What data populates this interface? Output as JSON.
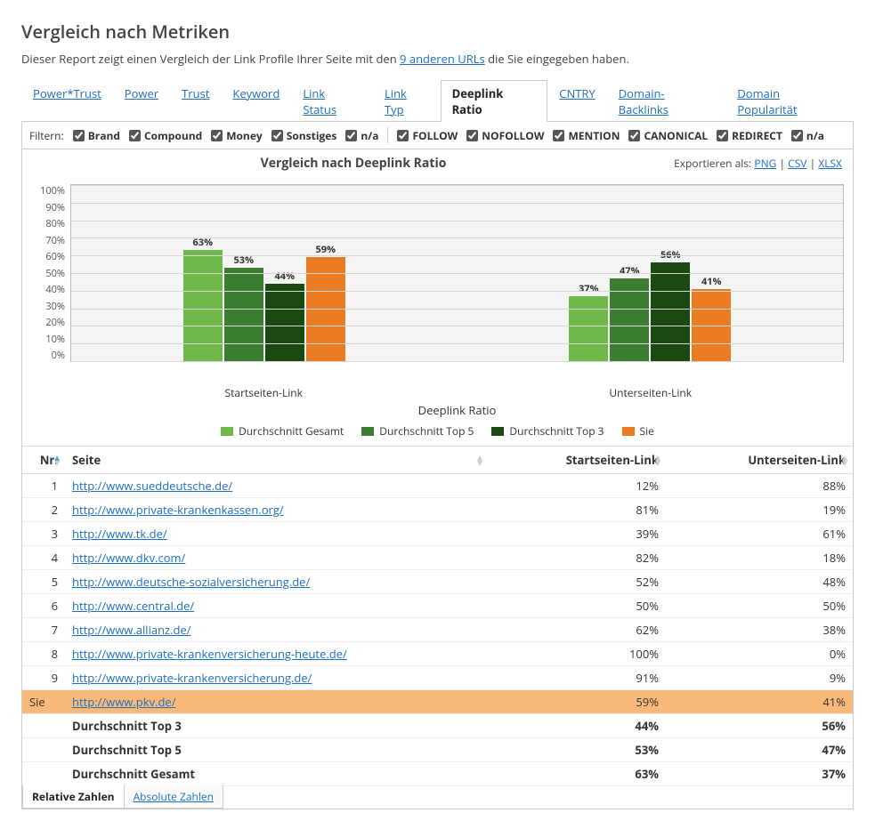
{
  "title": "Vergleich nach Metriken",
  "subtitle_a": "Dieser Report zeigt einen Vergleich der Link Profile Ihrer Seite mit den ",
  "subtitle_link": "9 anderen URLs",
  "subtitle_b": " die Sie eingegeben haben.",
  "tabs": [
    "Power*Trust",
    "Power",
    "Trust",
    "Keyword",
    "Link Status",
    "Link Typ",
    "Deeplink Ratio",
    "CNTRY",
    "Domain-Backlinks",
    "Domain Popularität"
  ],
  "active_tab": "Deeplink Ratio",
  "filter_label": "Filtern:",
  "filters_a": [
    "Brand",
    "Compound",
    "Money",
    "Sonstiges",
    "n/a"
  ],
  "filters_b": [
    "FOLLOW",
    "NOFOLLOW",
    "MENTION",
    "CANONICAL",
    "REDIRECT",
    "n/a"
  ],
  "chart_title": "Vergleich nach Deeplink Ratio",
  "export_label": "Exportieren als:",
  "export_formats": [
    "PNG",
    "CSV",
    "XLSX"
  ],
  "yticks": [
    "100%",
    "90%",
    "80%",
    "70%",
    "60%",
    "50%",
    "40%",
    "30%",
    "20%",
    "10%",
    "0%"
  ],
  "xlabel": "Deeplink Ratio",
  "legend": [
    "Durchschnitt Gesamt",
    "Durchschnitt Top 5",
    "Durchschnitt Top 3",
    "Sie"
  ],
  "cols": {
    "nr": "Nr.",
    "seite": "Seite",
    "start": "Startseiten-Link",
    "unter": "Unterseiten-Link"
  },
  "rows": [
    {
      "nr": "1",
      "url": "http://www.sueddeutsche.de/",
      "s": "12%",
      "u": "88%"
    },
    {
      "nr": "2",
      "url": "http://www.private-krankenkassen.org/",
      "s": "81%",
      "u": "19%"
    },
    {
      "nr": "3",
      "url": "http://www.tk.de/",
      "s": "39%",
      "u": "61%"
    },
    {
      "nr": "4",
      "url": "http://www.dkv.com/",
      "s": "82%",
      "u": "18%"
    },
    {
      "nr": "5",
      "url": "http://www.deutsche-sozialversicherung.de/",
      "s": "52%",
      "u": "48%"
    },
    {
      "nr": "6",
      "url": "http://www.central.de/",
      "s": "50%",
      "u": "50%"
    },
    {
      "nr": "7",
      "url": "http://www.allianz.de/",
      "s": "62%",
      "u": "38%"
    },
    {
      "nr": "8",
      "url": "http://www.private-krankenversicherung-heute.de/",
      "s": "100%",
      "u": "0%"
    },
    {
      "nr": "9",
      "url": "http://www.private-krankenversicherung.de/",
      "s": "91%",
      "u": "9%"
    }
  ],
  "hl": {
    "nr": "Sie",
    "url": "http://www.pkv.de/",
    "s": "59%",
    "u": "41%"
  },
  "sums": [
    {
      "label": "Durchschnitt Top 3",
      "s": "44%",
      "u": "56%"
    },
    {
      "label": "Durchschnitt Top 5",
      "s": "53%",
      "u": "47%"
    },
    {
      "label": "Durchschnitt Gesamt",
      "s": "63%",
      "u": "37%"
    }
  ],
  "bottom_tabs": [
    "Relative Zahlen",
    "Absolute Zahlen"
  ],
  "chart_data": {
    "type": "bar",
    "title": "Vergleich nach Deeplink Ratio",
    "xlabel": "Deeplink Ratio",
    "ylabel": "",
    "ylim": [
      0,
      100
    ],
    "categories": [
      "Startseiten-Link",
      "Unterseiten-Link"
    ],
    "series": [
      {
        "name": "Durchschnitt Gesamt",
        "values": [
          63,
          37
        ],
        "color": "#6fb94a"
      },
      {
        "name": "Durchschnitt Top 5",
        "values": [
          53,
          47
        ],
        "color": "#3c7d32"
      },
      {
        "name": "Durchschnitt Top 3",
        "values": [
          44,
          56
        ],
        "color": "#1a4a12"
      },
      {
        "name": "Sie",
        "values": [
          59,
          41
        ],
        "color": "#e87b23"
      }
    ]
  }
}
